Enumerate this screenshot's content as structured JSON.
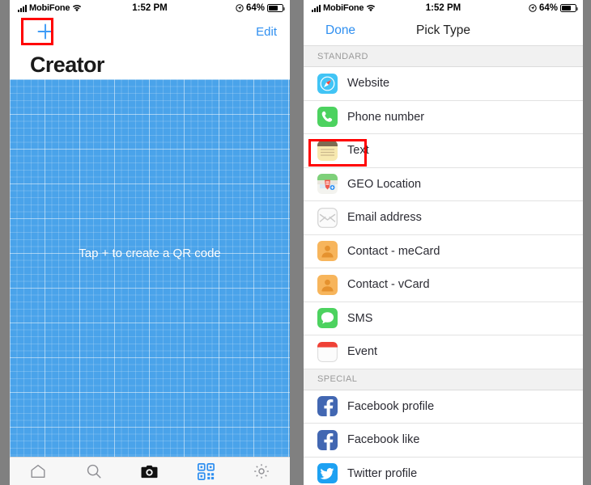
{
  "statusbar": {
    "carrier": "MobiFone",
    "time": "1:52 PM",
    "battery_percent": "64%",
    "signal_icon": "signal-bars-icon",
    "wifi_icon": "wifi-icon",
    "location_icon": "location-arrow-icon",
    "battery_icon": "battery-icon"
  },
  "left_phone": {
    "nav": {
      "add_label": "+",
      "add_icon": "plus-icon",
      "edit_label": "Edit"
    },
    "title": "Creator",
    "canvas": {
      "hint": "Tap + to create a QR code",
      "background_color": "#4aa3ea",
      "grid": "blueprint-grid"
    },
    "tabbar": {
      "items": [
        {
          "name": "home",
          "icon": "home-icon",
          "active": false
        },
        {
          "name": "search",
          "icon": "search-icon",
          "active": false
        },
        {
          "name": "camera",
          "icon": "camera-icon",
          "active": false
        },
        {
          "name": "qrcode",
          "icon": "qr-code-icon",
          "active": true
        },
        {
          "name": "settings",
          "icon": "gear-icon",
          "active": false
        }
      ],
      "active_color": "#2f8ff0",
      "inactive_color": "#8e8e93"
    },
    "highlight": {
      "target": "plus-button",
      "color": "#ff0000"
    }
  },
  "right_phone": {
    "nav": {
      "done_label": "Done",
      "title": "Pick Type"
    },
    "sections": [
      {
        "header": "STANDARD",
        "items": [
          {
            "label": "Website",
            "icon": "safari-compass-icon"
          },
          {
            "label": "Phone number",
            "icon": "phone-handset-icon"
          },
          {
            "label": "Text",
            "icon": "notes-icon"
          },
          {
            "label": "GEO Location",
            "icon": "maps-icon"
          },
          {
            "label": "Email address",
            "icon": "envelope-icon"
          },
          {
            "label": "Contact - meCard",
            "icon": "contact-person-icon"
          },
          {
            "label": "Contact - vCard",
            "icon": "contact-person-icon"
          },
          {
            "label": "SMS",
            "icon": "message-bubble-icon"
          },
          {
            "label": "Event",
            "icon": "calendar-icon"
          }
        ]
      },
      {
        "header": "SPECIAL",
        "items": [
          {
            "label": "Facebook profile",
            "icon": "facebook-icon"
          },
          {
            "label": "Facebook like",
            "icon": "facebook-icon"
          },
          {
            "label": "Twitter profile",
            "icon": "twitter-icon"
          }
        ]
      }
    ],
    "highlight": {
      "target": "list-item-text",
      "color": "#ff0000"
    }
  }
}
